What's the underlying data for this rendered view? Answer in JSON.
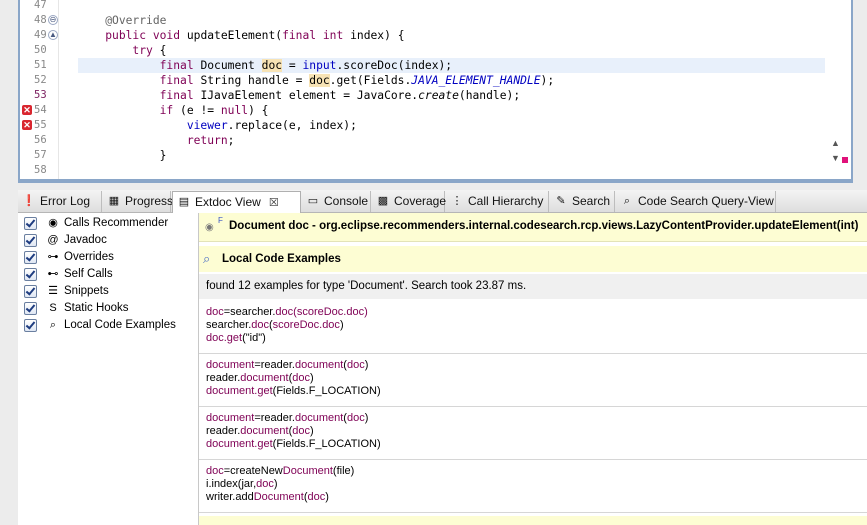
{
  "editor": {
    "lines": [
      {
        "num": "47",
        "tokens": []
      },
      {
        "num": "48",
        "tokens": [
          {
            "t": "    "
          },
          {
            "t": "@Override",
            "c": "ann"
          }
        ]
      },
      {
        "num": "49",
        "tokens": [
          {
            "t": "    "
          },
          {
            "t": "public void",
            "c": "kw"
          },
          {
            "t": " updateElement("
          },
          {
            "t": "final int",
            "c": "kw"
          },
          {
            "t": " index) {"
          }
        ]
      },
      {
        "num": "50",
        "tokens": [
          {
            "t": "        "
          },
          {
            "t": "try",
            "c": "kw"
          },
          {
            "t": " {"
          }
        ]
      },
      {
        "num": "51",
        "tokens": [
          {
            "t": "            "
          },
          {
            "t": "final",
            "c": "kw"
          },
          {
            "t": " Document "
          },
          {
            "t": "doc",
            "c": "mark"
          },
          {
            "t": " = "
          },
          {
            "t": "input",
            "c": "vf"
          },
          {
            "t": ".scoreDoc(index);"
          }
        ]
      },
      {
        "num": "52",
        "tokens": [
          {
            "t": "            "
          },
          {
            "t": "final",
            "c": "kw"
          },
          {
            "t": " String handle = "
          },
          {
            "t": "doc",
            "c": "mark"
          },
          {
            "t": ".get(Fields."
          },
          {
            "t": "JAVA_ELEMENT_HANDLE",
            "c": "fld"
          },
          {
            "t": ");"
          }
        ]
      },
      {
        "num": "53",
        "tokens": [
          {
            "t": "            "
          },
          {
            "t": "final",
            "c": "kw"
          },
          {
            "t": " IJavaElement element = JavaCore."
          },
          {
            "t": "create",
            "c": "smeth"
          },
          {
            "t": "(handle);"
          }
        ]
      },
      {
        "num": "54",
        "tokens": [
          {
            "t": "            "
          },
          {
            "t": "if",
            "c": "kw"
          },
          {
            "t": " (e != "
          },
          {
            "t": "null",
            "c": "kw"
          },
          {
            "t": ") {"
          }
        ]
      },
      {
        "num": "55",
        "tokens": [
          {
            "t": "                "
          },
          {
            "t": "viewer",
            "c": "vf"
          },
          {
            "t": ".replace(e, index);"
          }
        ]
      },
      {
        "num": "56",
        "tokens": [
          {
            "t": "                "
          },
          {
            "t": "return",
            "c": "kw"
          },
          {
            "t": ";"
          }
        ]
      },
      {
        "num": "57",
        "tokens": [
          {
            "t": "            }"
          }
        ]
      },
      {
        "num": "58",
        "tokens": []
      }
    ]
  },
  "tabs": [
    {
      "label": "Error Log",
      "icon": "error-log-icon",
      "glyph": "❗"
    },
    {
      "label": "Progress",
      "icon": "progress-icon",
      "glyph": "▦"
    },
    {
      "label": "Extdoc View",
      "icon": "extdoc-icon",
      "glyph": "▤"
    },
    {
      "label": "Console",
      "icon": "console-icon",
      "glyph": "▭"
    },
    {
      "label": "Coverage",
      "icon": "coverage-icon",
      "glyph": "▩"
    },
    {
      "label": "Call Hierarchy",
      "icon": "call-hierarchy-icon",
      "glyph": "⋮"
    },
    {
      "label": "Search",
      "icon": "search-icon",
      "glyph": "✎"
    },
    {
      "label": "Code Search Query-View",
      "icon": "magnifier-icon",
      "glyph": "⌕"
    }
  ],
  "active_tab_close": "☒",
  "providers": [
    {
      "label": "Calls Recommender",
      "icon": "calls-recommender-icon",
      "glyph": "◉"
    },
    {
      "label": "Javadoc",
      "icon": "javadoc-icon",
      "glyph": "@"
    },
    {
      "label": "Overrides",
      "icon": "overrides-icon",
      "glyph": "⊶"
    },
    {
      "label": "Self Calls",
      "icon": "self-calls-icon",
      "glyph": "⊷"
    },
    {
      "label": "Snippets",
      "icon": "snippets-icon",
      "glyph": "☰"
    },
    {
      "label": "Static Hooks",
      "icon": "static-hooks-icon",
      "glyph": "S"
    },
    {
      "label": "Local Code Examples",
      "icon": "local-code-examples-icon",
      "glyph": "⌕"
    }
  ],
  "header": {
    "sup": "F",
    "title": "Document doc - org.eclipse.recommenders.internal.codesearch.rcp.views.LazyContentProvider.updateElement(int)"
  },
  "section": {
    "title": "Local Code Examples"
  },
  "summary": "found 12 examples for type 'Document'. Search took 23.87 ms.",
  "examples": [
    [
      [
        {
          "t": "doc",
          "c": "p"
        },
        {
          "t": "=searcher."
        },
        {
          "t": "doc(scoreDoc.doc)",
          "c": "p"
        }
      ],
      [
        {
          "t": "searcher."
        },
        {
          "t": "doc",
          "c": "p"
        },
        {
          "t": "("
        },
        {
          "t": "scoreDoc.doc",
          "c": "p"
        },
        {
          "t": ")"
        }
      ],
      [
        {
          "t": "doc.get",
          "c": "p"
        },
        {
          "t": "(\"id\")"
        }
      ]
    ],
    [
      [
        {
          "t": "document",
          "c": "p"
        },
        {
          "t": "=reader."
        },
        {
          "t": "document",
          "c": "p"
        },
        {
          "t": "("
        },
        {
          "t": "doc",
          "c": "p"
        },
        {
          "t": ")"
        }
      ],
      [
        {
          "t": "reader."
        },
        {
          "t": "document",
          "c": "p"
        },
        {
          "t": "("
        },
        {
          "t": "doc",
          "c": "p"
        },
        {
          "t": ")"
        }
      ],
      [
        {
          "t": "document.get",
          "c": "p"
        },
        {
          "t": "(Fields.F_LOCATION)"
        }
      ]
    ],
    [
      [
        {
          "t": "document",
          "c": "p"
        },
        {
          "t": "=reader."
        },
        {
          "t": "document",
          "c": "p"
        },
        {
          "t": "("
        },
        {
          "t": "doc",
          "c": "p"
        },
        {
          "t": ")"
        }
      ],
      [
        {
          "t": "reader."
        },
        {
          "t": "document",
          "c": "p"
        },
        {
          "t": "("
        },
        {
          "t": "doc",
          "c": "p"
        },
        {
          "t": ")"
        }
      ],
      [
        {
          "t": "document.get",
          "c": "p"
        },
        {
          "t": "(Fields.F_LOCATION)"
        }
      ]
    ],
    [
      [
        {
          "t": "doc",
          "c": "p"
        },
        {
          "t": "=createNew"
        },
        {
          "t": "Document",
          "c": "p"
        },
        {
          "t": "(file)"
        }
      ],
      [
        {
          "t": "i.index(jar,"
        },
        {
          "t": "doc",
          "c": "p"
        },
        {
          "t": ")"
        }
      ],
      [
        {
          "t": "writer.add"
        },
        {
          "t": "Document",
          "c": "p"
        },
        {
          "t": "("
        },
        {
          "t": "doc",
          "c": "p"
        },
        {
          "t": ")"
        }
      ]
    ]
  ]
}
